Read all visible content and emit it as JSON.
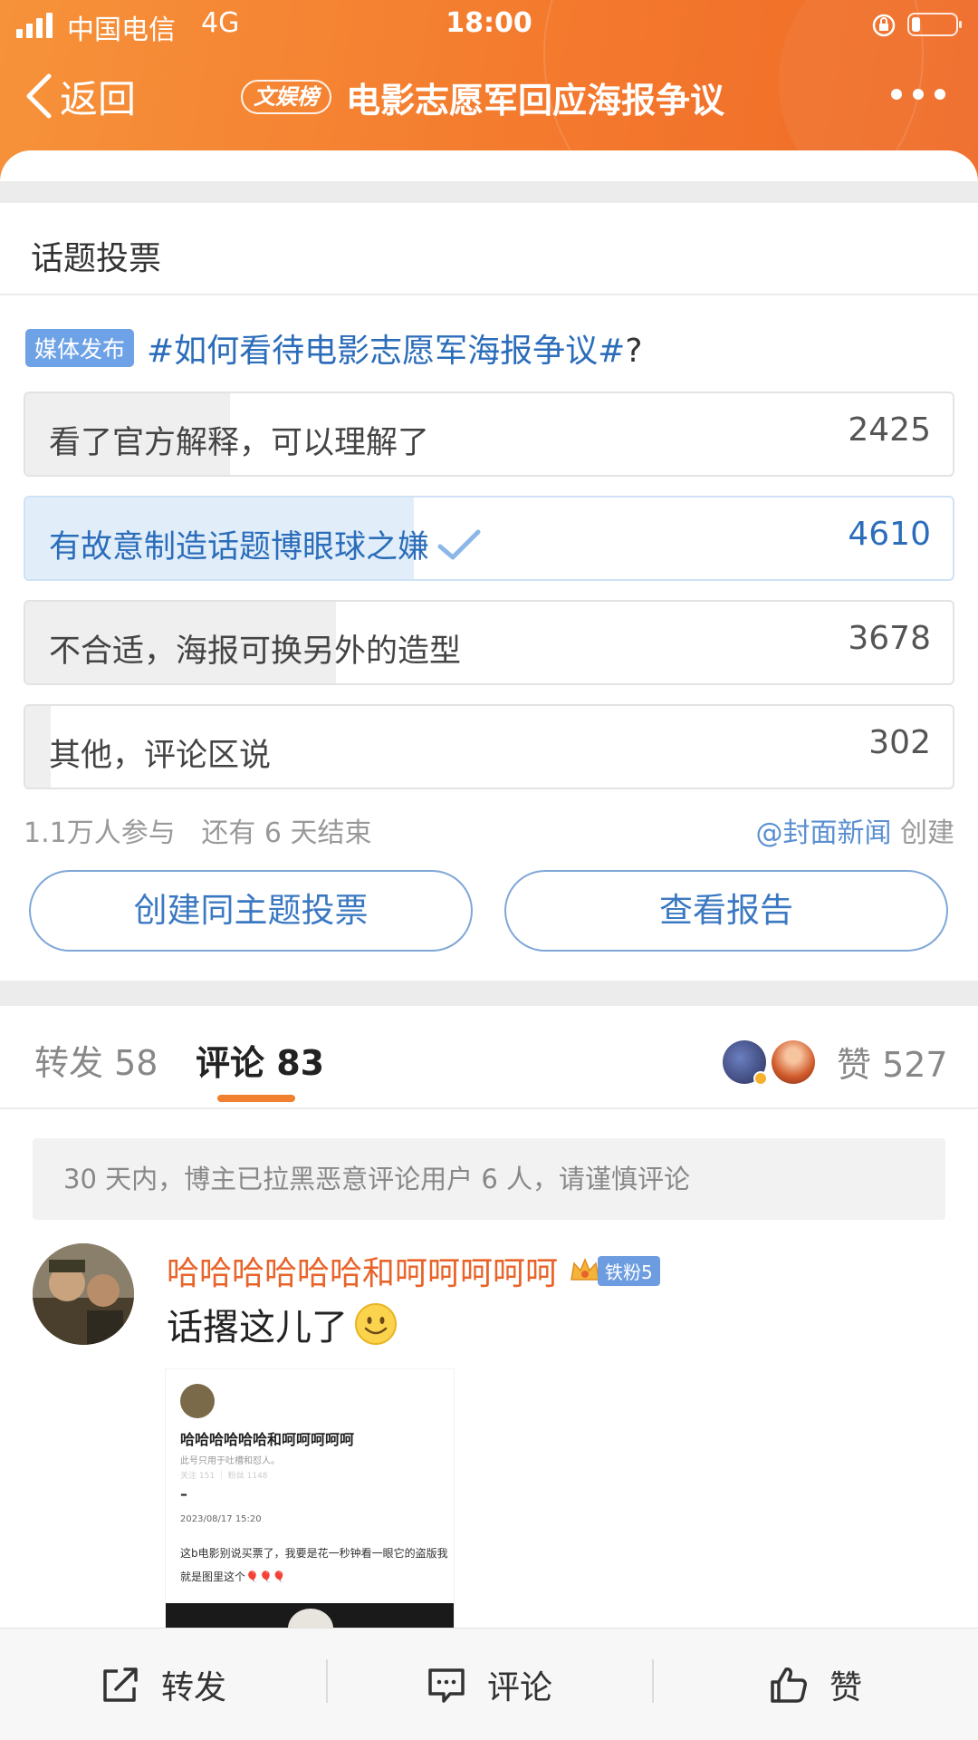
{
  "status_bar": {
    "carrier": "中国电信",
    "network": "4G",
    "time": "18:00"
  },
  "nav": {
    "back_label": "返回",
    "badge": "文娱榜",
    "title": "电影志愿军回应海报争议"
  },
  "vote": {
    "section_title": "话题投票",
    "media_tag": "媒体发布",
    "topic": "#如何看待电影志愿军海报争议#",
    "topic_suffix": "?",
    "options": [
      {
        "label": "看了官方解释，可以理解了",
        "count": "2425",
        "share": 0.2206,
        "selected": false
      },
      {
        "label": "有故意制造话题博眼球之嫌",
        "count": "4610",
        "share": 0.4194,
        "selected": true
      },
      {
        "label": "不合适，海报可换另外的造型",
        "count": "3678",
        "share": 0.3346,
        "selected": false
      },
      {
        "label": "其他，评论区说",
        "count": "302",
        "share": 0.0275,
        "selected": false
      }
    ],
    "participants": "1.1万人参与",
    "remaining": "还有 6 天结束",
    "creator": "@封面新闻",
    "creator_suffix": "创建",
    "btn_create": "创建同主题投票",
    "btn_report": "查看报告"
  },
  "tabs": {
    "forward_label": "转发 58",
    "comment_label": "评论 83",
    "like_label": "赞 527"
  },
  "notice": "30 天内，博主已拉黑恶意评论用户 6 人，请谨慎评论",
  "comment": {
    "username": "哈哈哈哈哈哈和呵呵呵呵呵",
    "fan_badge": "铁粉5",
    "text": "话撂这儿了",
    "image": {
      "name": "哈哈哈哈哈哈和呵呵呵呵呵",
      "signature": "此号只用于吐槽和怼人。",
      "stats": "关注 151 ｜ 粉丝 1148",
      "dash": "–",
      "date": "2023/08/17 15:20",
      "body": "这b电影别说买票了，我要是花一秒钟看一眼它的盗版我就是图里这个🎈🎈🎈"
    }
  },
  "bottom_bar": {
    "forward": "转发",
    "comment": "评论",
    "like": "赞"
  },
  "colors": {
    "header": "#f47a2e",
    "accent_blue": "#2b6dba",
    "accent_orange": "#e8642a"
  }
}
